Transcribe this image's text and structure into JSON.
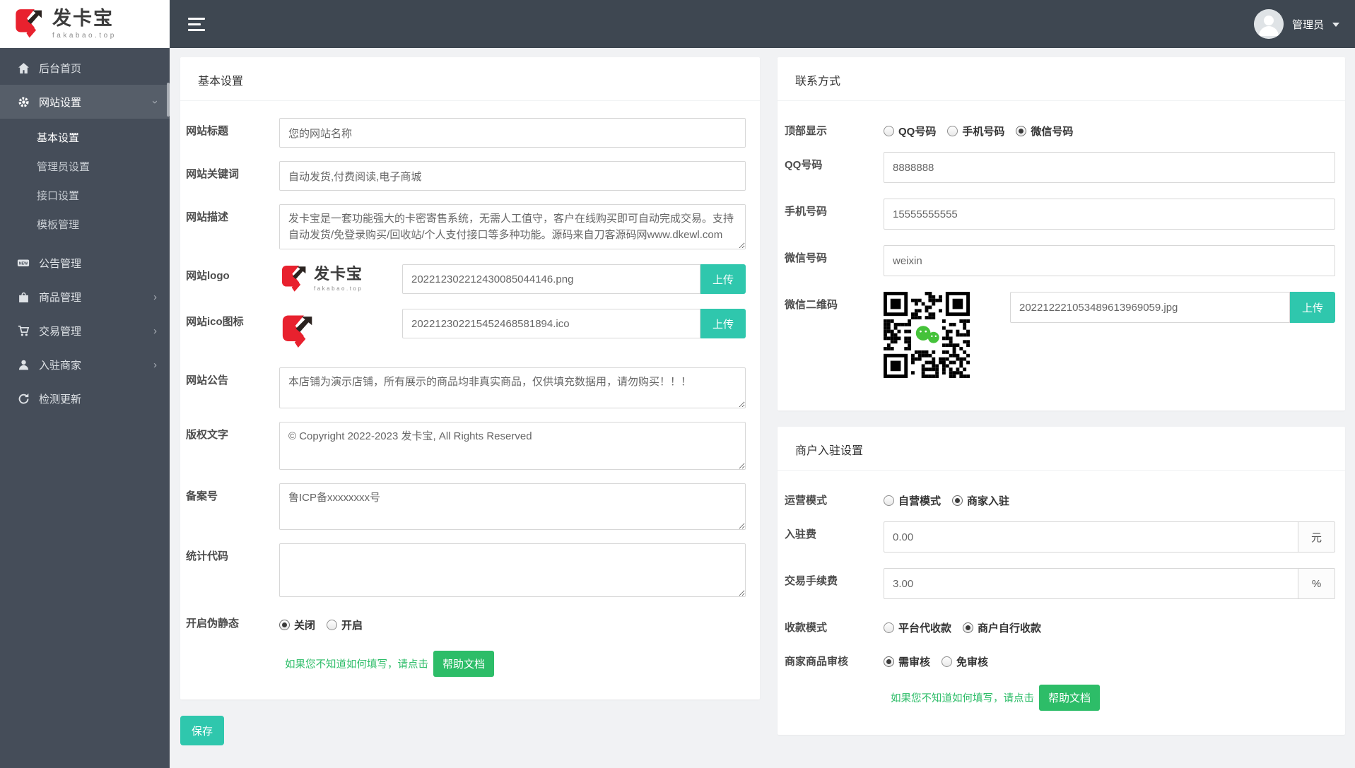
{
  "brand": {
    "name": "发卡宝",
    "domain": "fakabao.top"
  },
  "topbar": {
    "username": "管理员"
  },
  "sidebar": {
    "new_badge": "NEW",
    "items": [
      {
        "label": "后台首页"
      },
      {
        "label": "网站设置",
        "children": [
          {
            "label": "基本设置",
            "active": true
          },
          {
            "label": "管理员设置"
          },
          {
            "label": "接口设置"
          },
          {
            "label": "模板管理"
          }
        ]
      },
      {
        "label": "公告管理"
      },
      {
        "label": "商品管理"
      },
      {
        "label": "交易管理"
      },
      {
        "label": "入驻商家"
      },
      {
        "label": "检测更新"
      }
    ]
  },
  "basic_panel": {
    "title": "基本设置",
    "site_title": {
      "label": "网站标题",
      "value": "您的网站名称"
    },
    "keywords": {
      "label": "网站关键词",
      "value": "自动发货,付费阅读,电子商城"
    },
    "description": {
      "label": "网站描述",
      "value": "发卡宝是一套功能强大的卡密寄售系统，无需人工值守，客户在线购买即可自动完成交易。支持自动发货/免登录购买/回收站/个人支付接口等多种功能。源码来自刀客源码网www.dkewl.com"
    },
    "logo": {
      "label": "网站logo",
      "filename": "202212302212430085044146.png",
      "upload_label": "上传"
    },
    "ico": {
      "label": "网站ico图标",
      "filename": "202212302215452468581894.ico",
      "upload_label": "上传"
    },
    "notice": {
      "label": "网站公告",
      "value": "本店铺为演示店铺，所有展示的商品均非真实商品，仅供填充数据用，请勿购买！！！"
    },
    "copyright": {
      "label": "版权文字",
      "value": "© Copyright 2022-2023 发卡宝, All Rights Reserved"
    },
    "icp": {
      "label": "备案号",
      "value": "鲁ICP备xxxxxxxx号"
    },
    "analytics": {
      "label": "统计代码",
      "value": ""
    },
    "pseudo_static": {
      "label": "开启伪静态",
      "options": [
        {
          "label": "关闭",
          "selected": true
        },
        {
          "label": "开启",
          "selected": false
        }
      ]
    },
    "help_text": "如果您不知道如何填写，请点击",
    "help_button": "帮助文档",
    "save_button": "保存"
  },
  "contact_panel": {
    "title": "联系方式",
    "top_display": {
      "label": "顶部显示",
      "options": [
        {
          "label": "QQ号码",
          "selected": false
        },
        {
          "label": "手机号码",
          "selected": false
        },
        {
          "label": "微信号码",
          "selected": true
        }
      ]
    },
    "qq": {
      "label": "QQ号码",
      "value": "8888888"
    },
    "phone": {
      "label": "手机号码",
      "value": "15555555555"
    },
    "wechat": {
      "label": "微信号码",
      "value": "weixin"
    },
    "wechat_qr": {
      "label": "微信二维码",
      "filename": "202212221053489613969059.jpg",
      "upload_label": "上传"
    }
  },
  "merchant_panel": {
    "title": "商户入驻设置",
    "operation_mode": {
      "label": "运营模式",
      "options": [
        {
          "label": "自营模式",
          "selected": false
        },
        {
          "label": "商家入驻",
          "selected": true
        }
      ]
    },
    "entry_fee": {
      "label": "入驻费",
      "value": "0.00",
      "unit": "元"
    },
    "transaction_fee": {
      "label": "交易手续费",
      "value": "3.00",
      "unit": "%"
    },
    "collection_mode": {
      "label": "收款模式",
      "options": [
        {
          "label": "平台代收款",
          "selected": false
        },
        {
          "label": "商户自行收款",
          "selected": true
        }
      ]
    },
    "product_audit": {
      "label": "商家商品审核",
      "options": [
        {
          "label": "需审核",
          "selected": true
        },
        {
          "label": "免审核",
          "selected": false
        }
      ]
    },
    "help_text": "如果您不知道如何填写，请点击",
    "help_button": "帮助文档"
  },
  "colors": {
    "accent_teal": "#2fc7ad",
    "accent_green": "#2dbd68",
    "brand_red": "#e8212e",
    "sidebar_dark": "#454d59",
    "topbar_dark": "#3e4751"
  }
}
